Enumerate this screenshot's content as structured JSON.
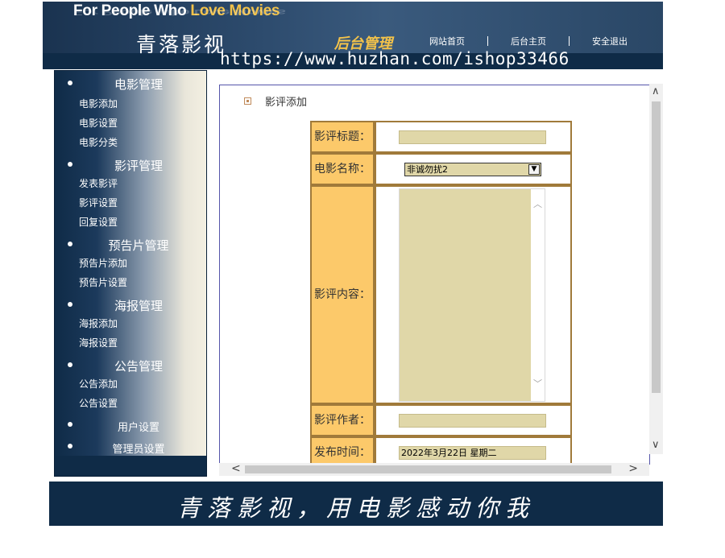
{
  "header": {
    "slogan_part1": "For People Who ",
    "slogan_part2": "Love Movies",
    "site_name": "青落影视",
    "admin_title": "后台管理",
    "nav": [
      "网站首页",
      "后台主页",
      "安全退出"
    ],
    "watermark": "https://www.huzhan.com/ishop33466"
  },
  "sidebar": {
    "groups": [
      {
        "title": "电影管理",
        "items": [
          "电影添加",
          "电影设置",
          "电影分类"
        ]
      },
      {
        "title": "影评管理",
        "items": [
          "发表影评",
          "影评设置",
          "回复设置"
        ]
      },
      {
        "title": "预告片管理",
        "items": [
          "预告片添加",
          "预告片设置"
        ]
      },
      {
        "title": "海报管理",
        "items": [
          "海报添加",
          "海报设置"
        ]
      },
      {
        "title": "公告管理",
        "items": [
          "公告添加",
          "公告设置"
        ]
      },
      {
        "title": "用户设置",
        "items": []
      },
      {
        "title": "管理员设置",
        "items": []
      }
    ]
  },
  "form": {
    "heading": "影评添加",
    "labels": {
      "title": "影评标题：",
      "movie": "电影名称：",
      "content": "影评内容：",
      "author": "影评作者：",
      "date": "发布时间："
    },
    "values": {
      "title": "",
      "movie": "非诚勿扰2",
      "content": "",
      "author": "",
      "date": "2022年3月22日 星期二"
    }
  },
  "footer": {
    "text": "青落影视，用电影感动你我"
  },
  "colors": {
    "navy": "#0f2b47",
    "label_bg": "#fcc96a",
    "input_bg": "#e0d7a8",
    "accent_gold": "#f2c24a"
  }
}
